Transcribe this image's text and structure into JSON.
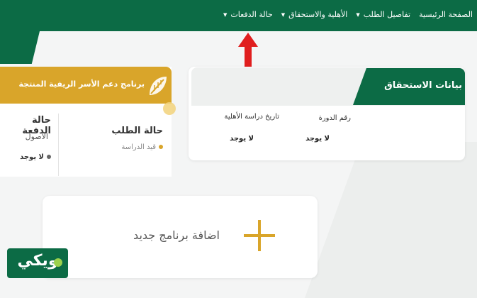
{
  "nav": {
    "items": [
      {
        "label": "الصفحة الرئيسية",
        "has_caret": false
      },
      {
        "label": "تفاصيل الطلب",
        "has_caret": true
      },
      {
        "label": "الأهلية والاستحقاق",
        "has_caret": true
      },
      {
        "label": "حالة الدفعات",
        "has_caret": true
      }
    ]
  },
  "eligibility": {
    "title": "بيانات الاستحقاق",
    "cycle_label": "رقم الدورة",
    "cycle_value": "لا يوجد",
    "study_date_label": "تاريخ دراسة الأهلية",
    "study_date_value": "لا يوجد"
  },
  "program": {
    "title": "برنامج دعم الأسر الريفية المنتجة",
    "request_status_label": "حالة الطلب",
    "request_status_value": "قيد الدراسة",
    "payment_status_label": "حالة الدفعة",
    "payment_sub_label": "الأصول",
    "payment_value": "لا يوجد"
  },
  "add_program": {
    "label": "اضافة برنامج جديد"
  },
  "logo": {
    "text": "ويكي"
  },
  "colors": {
    "primary_green": "#0c6b45",
    "gold": "#d9a52a",
    "arrow_red": "#e01e1e"
  }
}
